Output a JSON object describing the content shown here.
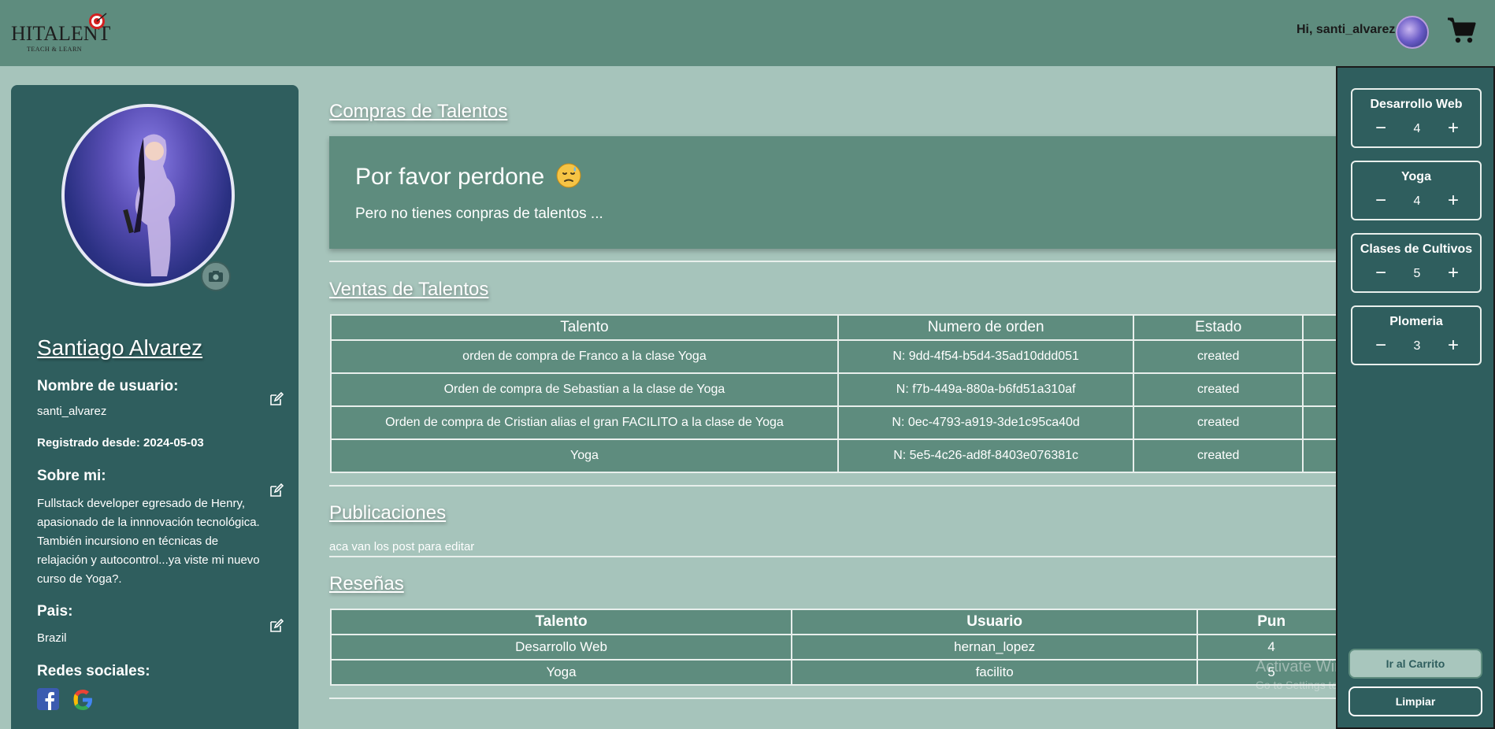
{
  "header": {
    "logo_main": "HITALENT",
    "logo_sub": "TEACH & LEARN",
    "greeting": "Hi, santi_alvarez"
  },
  "profile": {
    "name": "Santiago Alvarez",
    "username_label": "Nombre de usuario:",
    "username": "santi_alvarez",
    "registered": "Registrado desde: 2024-05-03",
    "about_label": "Sobre mi:",
    "about": "Fullstack developer egresado de Henry, apasionado de la innnovación tecnológica. También incursiono en técnicas de relajación y autocontrol...ya viste mi nuevo curso de Yoga?.",
    "country_label": "Pais:",
    "country": "Brazil",
    "social_label": "Redes sociales:"
  },
  "purchases": {
    "title": "Compras de Talentos",
    "empty_title": "Por favor perdone",
    "empty_text": "Pero no tienes conpras de talentos ..."
  },
  "sales": {
    "title": "Ventas de Talentos",
    "columns": [
      "Talento",
      "Numero de orden",
      "Estado"
    ],
    "rows": [
      {
        "talent": "orden de compra de Franco a la clase Yoga",
        "order": "N: 9dd-4f54-b5d4-35ad10ddd051",
        "status": "created"
      },
      {
        "talent": "Orden de compra de Sebastian a la clase de Yoga",
        "order": "N: f7b-449a-880a-b6fd51a310af",
        "status": "created"
      },
      {
        "talent": "Orden de compra de Cristian alias el gran FACILITO a la clase de Yoga",
        "order": "N: 0ec-4793-a919-3de1c95ca40d",
        "status": "created"
      },
      {
        "talent": "Yoga",
        "order": "N: 5e5-4c26-ad8f-8403e076381c",
        "status": "created"
      }
    ]
  },
  "posts": {
    "title": "Publicaciones",
    "text": "aca van los post para editar"
  },
  "reviews": {
    "title": "Reseñas",
    "columns": [
      "Talento",
      "Usuario",
      "Pun"
    ],
    "rows": [
      {
        "talent": "Desarrollo Web",
        "user": "hernan_lopez",
        "score": "4"
      },
      {
        "talent": "Yoga",
        "user": "facilito",
        "score": "5"
      }
    ]
  },
  "cart": {
    "items": [
      {
        "name": "Desarrollo Web",
        "qty": "4"
      },
      {
        "name": "Yoga",
        "qty": "4"
      },
      {
        "name": "Clases de Cultivos",
        "qty": "5"
      },
      {
        "name": "Plomeria",
        "qty": "3"
      }
    ],
    "go_cart_label": "Ir al Carrito",
    "clear_label": "Limpiar"
  },
  "watermark": {
    "title": "Activate Windows",
    "subtitle": "Go to Settings to activate Windows."
  },
  "colors": {
    "header": "#5e8c7e",
    "background": "#a6c4bb",
    "panel": "#2f5e5e"
  }
}
